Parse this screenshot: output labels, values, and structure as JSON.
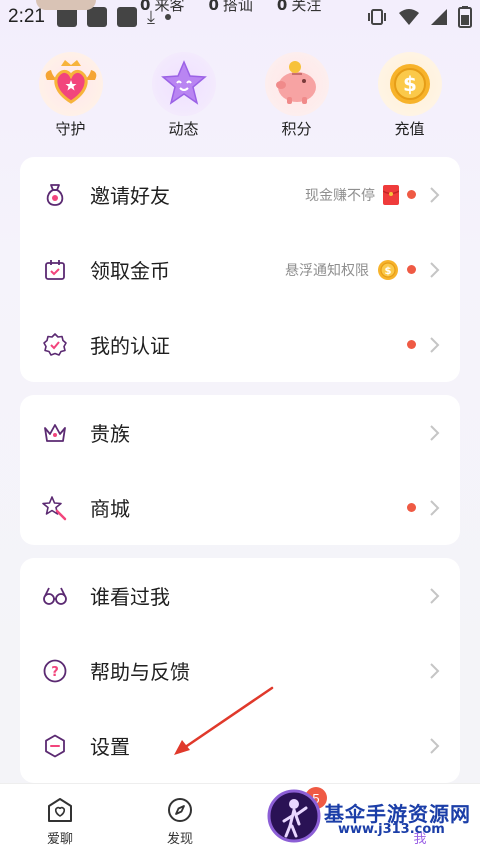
{
  "status_bar": {
    "time": "2:21"
  },
  "profile_stats": [
    {
      "value": "0",
      "label": "来客"
    },
    {
      "value": "0",
      "label": "搭讪"
    },
    {
      "value": "0",
      "label": "关注"
    }
  ],
  "quick_actions": [
    {
      "label": "守护",
      "icon": "guardian-heart-icon"
    },
    {
      "label": "动态",
      "icon": "star-face-icon"
    },
    {
      "label": "积分",
      "icon": "piggy-bank-icon"
    },
    {
      "label": "充值",
      "icon": "gold-coin-icon"
    }
  ],
  "menu_groups": [
    {
      "items": [
        {
          "label": "邀请好友",
          "hint": "现金赚不停",
          "icon": "money-bag-icon",
          "red_dot": true
        },
        {
          "label": "领取金币",
          "hint": "悬浮通知权限",
          "icon": "calendar-icon",
          "red_dot": true
        },
        {
          "label": "我的认证",
          "hint": "",
          "icon": "verified-badge-icon",
          "red_dot": true
        }
      ]
    },
    {
      "items": [
        {
          "label": "贵族",
          "hint": "",
          "icon": "crown-icon",
          "red_dot": false
        },
        {
          "label": "商城",
          "hint": "",
          "icon": "magic-wand-icon",
          "red_dot": true
        }
      ]
    },
    {
      "items": [
        {
          "label": "谁看过我",
          "hint": "",
          "icon": "glasses-icon",
          "red_dot": false
        },
        {
          "label": "帮助与反馈",
          "hint": "",
          "icon": "help-icon",
          "red_dot": false
        },
        {
          "label": "设置",
          "hint": "",
          "icon": "settings-icon",
          "red_dot": false
        }
      ]
    }
  ],
  "tab_bar": [
    {
      "label": "爱聊",
      "icon": "heart-chat-icon"
    },
    {
      "label": "发现",
      "icon": "compass-icon"
    },
    {
      "label": "",
      "icon": ""
    },
    {
      "label": "我",
      "icon": ""
    }
  ],
  "tab_badge": "5",
  "watermark": {
    "title": "基伞手游资源网",
    "url": "www.j313.com"
  },
  "colors": {
    "accent_red": "#ef5a44",
    "icon_purple": "#6a3a8a",
    "text": "#1f1f1f",
    "hint": "#8f8f8f"
  }
}
